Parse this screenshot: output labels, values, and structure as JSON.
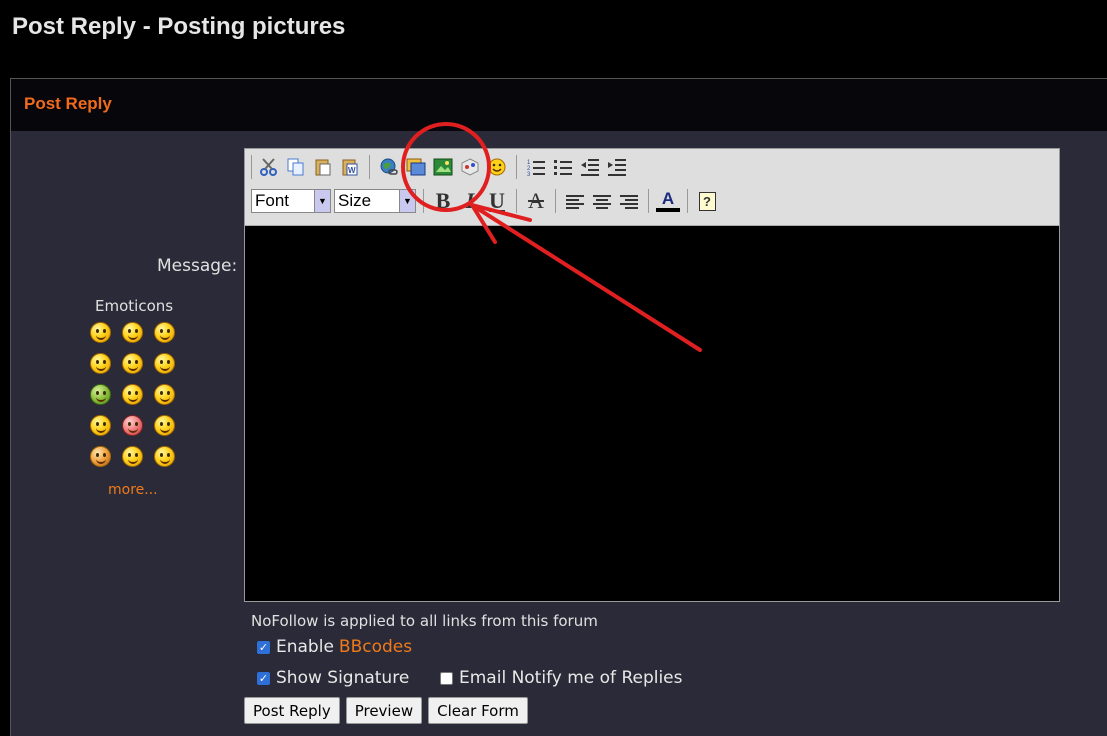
{
  "page": {
    "title": "Post Reply - Posting pictures"
  },
  "panel": {
    "header_title": "Post Reply"
  },
  "form": {
    "message_label": "Message:",
    "nofollow_note": "NoFollow is applied to all links from this forum"
  },
  "emoticons": {
    "title": "Emoticons",
    "more_label": "more...",
    "items": [
      "smile",
      "tongue",
      "wink",
      "confused",
      "laugh",
      "shy",
      "sick",
      "dizzy",
      "thinking",
      "cry",
      "angry",
      "sad",
      "star",
      "shocked",
      "sleepy"
    ]
  },
  "toolbar": {
    "font_select": "Font",
    "size_select": "Size",
    "row1_icons": [
      "cut-icon",
      "copy-icon",
      "paste-icon",
      "paste-word-icon",
      "insert-link-icon",
      "insert-image-icon",
      "upload-image-icon",
      "insert-object-icon",
      "insert-emoticon-icon",
      "ordered-list-icon",
      "unordered-list-icon",
      "outdent-icon",
      "indent-icon"
    ],
    "row2_icons": [
      "bold-icon",
      "italic-icon",
      "underline-icon",
      "strikethrough-icon",
      "align-left-icon",
      "align-center-icon",
      "align-right-icon",
      "font-color-icon",
      "help-icon"
    ],
    "bold_glyph": "B",
    "italic_glyph": "I",
    "underline_glyph": "U",
    "strike_glyph": "A",
    "color_glyph": "A",
    "help_glyph": "?"
  },
  "options": {
    "enable_bbcodes_prefix": "Enable",
    "enable_bbcodes_link": "BBcodes",
    "enable_bbcodes_checked": true,
    "show_signature_label": "Show Signature",
    "show_signature_checked": true,
    "email_notify_label": "Email Notify me of Replies",
    "email_notify_checked": false
  },
  "buttons": {
    "post_reply": "Post Reply",
    "preview": "Preview",
    "clear_form": "Clear Form"
  },
  "colors": {
    "accent": "#f26a1c",
    "panel_bg": "#2a2a38",
    "annotation": "#e02020"
  }
}
